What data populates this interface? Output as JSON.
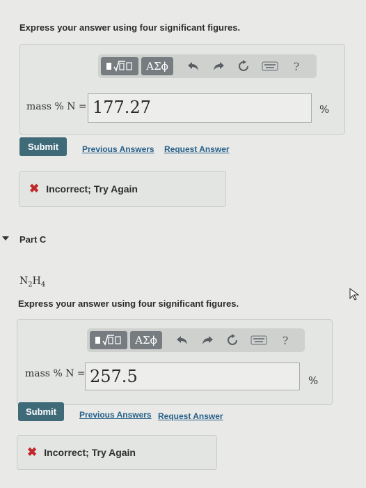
{
  "partB": {
    "instruction": "Express your answer using four significant figures.",
    "toolbar": {
      "templates_icon": "sqrt-template-icon",
      "greek_label": "ΑΣϕ",
      "help_label": "?"
    },
    "label": "mass % N =",
    "value": "177.27",
    "unit": "%",
    "submit_label": "Submit",
    "previous_answers": "Previous Answers",
    "request_answer": "Request Answer",
    "feedback": "Incorrect; Try Again",
    "feedback_mark": "✖"
  },
  "partC": {
    "header": "Part C",
    "formula_main": "N",
    "formula_sub1": "2",
    "formula_main2": "H",
    "formula_sub2": "4",
    "instruction": "Express your answer using four significant figures.",
    "toolbar": {
      "greek_label": "ΑΣϕ",
      "help_label": "?"
    },
    "label": "mass % N =",
    "value": "257.5",
    "unit": "%",
    "submit_label": "Submit",
    "previous_answers": "Previous Answers",
    "request_answer": "Request Answer",
    "feedback": "Incorrect; Try Again",
    "feedback_mark": "✖"
  }
}
